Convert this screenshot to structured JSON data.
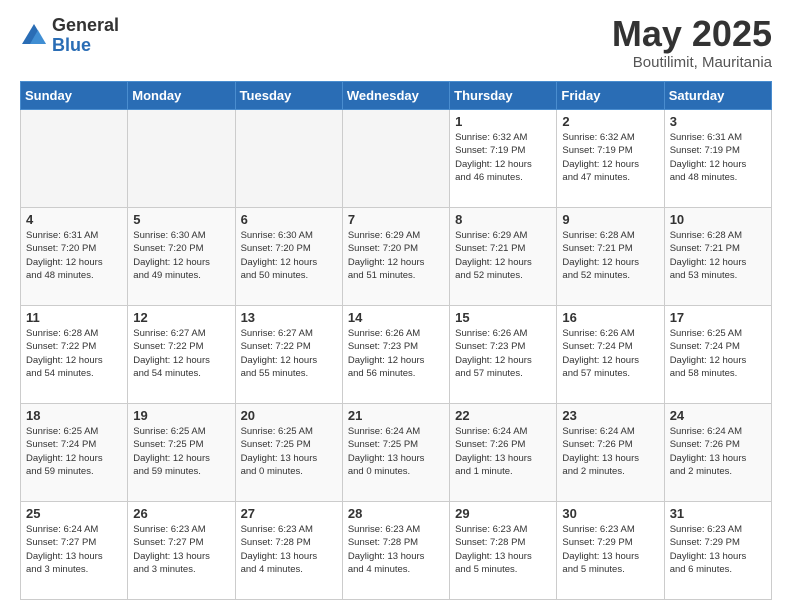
{
  "logo": {
    "general": "General",
    "blue": "Blue"
  },
  "header": {
    "month": "May 2025",
    "location": "Boutilimit, Mauritania"
  },
  "weekdays": [
    "Sunday",
    "Monday",
    "Tuesday",
    "Wednesday",
    "Thursday",
    "Friday",
    "Saturday"
  ],
  "weeks": [
    [
      {
        "day": "",
        "info": ""
      },
      {
        "day": "",
        "info": ""
      },
      {
        "day": "",
        "info": ""
      },
      {
        "day": "",
        "info": ""
      },
      {
        "day": "1",
        "info": "Sunrise: 6:32 AM\nSunset: 7:19 PM\nDaylight: 12 hours\nand 46 minutes."
      },
      {
        "day": "2",
        "info": "Sunrise: 6:32 AM\nSunset: 7:19 PM\nDaylight: 12 hours\nand 47 minutes."
      },
      {
        "day": "3",
        "info": "Sunrise: 6:31 AM\nSunset: 7:19 PM\nDaylight: 12 hours\nand 48 minutes."
      }
    ],
    [
      {
        "day": "4",
        "info": "Sunrise: 6:31 AM\nSunset: 7:20 PM\nDaylight: 12 hours\nand 48 minutes."
      },
      {
        "day": "5",
        "info": "Sunrise: 6:30 AM\nSunset: 7:20 PM\nDaylight: 12 hours\nand 49 minutes."
      },
      {
        "day": "6",
        "info": "Sunrise: 6:30 AM\nSunset: 7:20 PM\nDaylight: 12 hours\nand 50 minutes."
      },
      {
        "day": "7",
        "info": "Sunrise: 6:29 AM\nSunset: 7:20 PM\nDaylight: 12 hours\nand 51 minutes."
      },
      {
        "day": "8",
        "info": "Sunrise: 6:29 AM\nSunset: 7:21 PM\nDaylight: 12 hours\nand 52 minutes."
      },
      {
        "day": "9",
        "info": "Sunrise: 6:28 AM\nSunset: 7:21 PM\nDaylight: 12 hours\nand 52 minutes."
      },
      {
        "day": "10",
        "info": "Sunrise: 6:28 AM\nSunset: 7:21 PM\nDaylight: 12 hours\nand 53 minutes."
      }
    ],
    [
      {
        "day": "11",
        "info": "Sunrise: 6:28 AM\nSunset: 7:22 PM\nDaylight: 12 hours\nand 54 minutes."
      },
      {
        "day": "12",
        "info": "Sunrise: 6:27 AM\nSunset: 7:22 PM\nDaylight: 12 hours\nand 54 minutes."
      },
      {
        "day": "13",
        "info": "Sunrise: 6:27 AM\nSunset: 7:22 PM\nDaylight: 12 hours\nand 55 minutes."
      },
      {
        "day": "14",
        "info": "Sunrise: 6:26 AM\nSunset: 7:23 PM\nDaylight: 12 hours\nand 56 minutes."
      },
      {
        "day": "15",
        "info": "Sunrise: 6:26 AM\nSunset: 7:23 PM\nDaylight: 12 hours\nand 57 minutes."
      },
      {
        "day": "16",
        "info": "Sunrise: 6:26 AM\nSunset: 7:24 PM\nDaylight: 12 hours\nand 57 minutes."
      },
      {
        "day": "17",
        "info": "Sunrise: 6:25 AM\nSunset: 7:24 PM\nDaylight: 12 hours\nand 58 minutes."
      }
    ],
    [
      {
        "day": "18",
        "info": "Sunrise: 6:25 AM\nSunset: 7:24 PM\nDaylight: 12 hours\nand 59 minutes."
      },
      {
        "day": "19",
        "info": "Sunrise: 6:25 AM\nSunset: 7:25 PM\nDaylight: 12 hours\nand 59 minutes."
      },
      {
        "day": "20",
        "info": "Sunrise: 6:25 AM\nSunset: 7:25 PM\nDaylight: 13 hours\nand 0 minutes."
      },
      {
        "day": "21",
        "info": "Sunrise: 6:24 AM\nSunset: 7:25 PM\nDaylight: 13 hours\nand 0 minutes."
      },
      {
        "day": "22",
        "info": "Sunrise: 6:24 AM\nSunset: 7:26 PM\nDaylight: 13 hours\nand 1 minute."
      },
      {
        "day": "23",
        "info": "Sunrise: 6:24 AM\nSunset: 7:26 PM\nDaylight: 13 hours\nand 2 minutes."
      },
      {
        "day": "24",
        "info": "Sunrise: 6:24 AM\nSunset: 7:26 PM\nDaylight: 13 hours\nand 2 minutes."
      }
    ],
    [
      {
        "day": "25",
        "info": "Sunrise: 6:24 AM\nSunset: 7:27 PM\nDaylight: 13 hours\nand 3 minutes."
      },
      {
        "day": "26",
        "info": "Sunrise: 6:23 AM\nSunset: 7:27 PM\nDaylight: 13 hours\nand 3 minutes."
      },
      {
        "day": "27",
        "info": "Sunrise: 6:23 AM\nSunset: 7:28 PM\nDaylight: 13 hours\nand 4 minutes."
      },
      {
        "day": "28",
        "info": "Sunrise: 6:23 AM\nSunset: 7:28 PM\nDaylight: 13 hours\nand 4 minutes."
      },
      {
        "day": "29",
        "info": "Sunrise: 6:23 AM\nSunset: 7:28 PM\nDaylight: 13 hours\nand 5 minutes."
      },
      {
        "day": "30",
        "info": "Sunrise: 6:23 AM\nSunset: 7:29 PM\nDaylight: 13 hours\nand 5 minutes."
      },
      {
        "day": "31",
        "info": "Sunrise: 6:23 AM\nSunset: 7:29 PM\nDaylight: 13 hours\nand 6 minutes."
      }
    ]
  ]
}
